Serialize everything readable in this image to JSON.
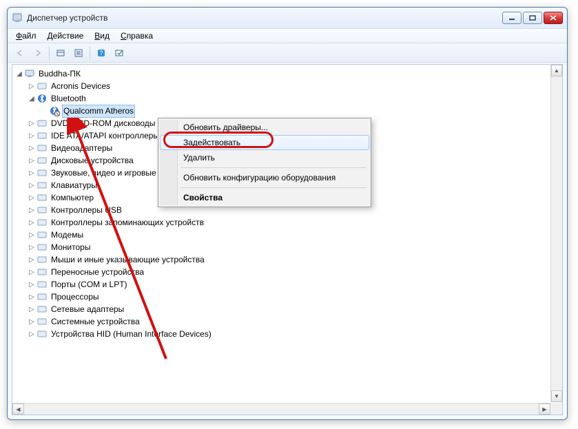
{
  "window": {
    "title": "Диспетчер устройств"
  },
  "menu": {
    "file": "Файл",
    "file_u": "Ф",
    "action": "Действие",
    "action_u": "Д",
    "view": "Вид",
    "view_u": "В",
    "help": "Справка",
    "help_u": "С"
  },
  "tree": {
    "root": "Buddha-ПК",
    "items": [
      "Acronis Devices",
      "Bluetooth",
      "DVD и CD-ROM дисководы",
      "IDE ATA/ATAPI контроллеры",
      "Видеоадаптеры",
      "Дисковые устройства",
      "Звуковые, видео и игровые устройства",
      "Клавиатуры",
      "Компьютер",
      "Контроллеры USB",
      "Контроллеры запоминающих устройств",
      "Модемы",
      "Мониторы",
      "Мыши и иные указывающие устройства",
      "Переносные устройства",
      "Порты (COM и LPT)",
      "Процессоры",
      "Сетевые адаптеры",
      "Системные устройства",
      "Устройства HID (Human Interface Devices)"
    ],
    "bluetooth_child": "Qualcomm Atheros"
  },
  "context": {
    "update_drivers": "Обновить драйверы...",
    "enable": "Задействовать",
    "delete": "Удалить",
    "scan_hw": "Обновить конфигурацию оборудования",
    "properties": "Свойства"
  }
}
